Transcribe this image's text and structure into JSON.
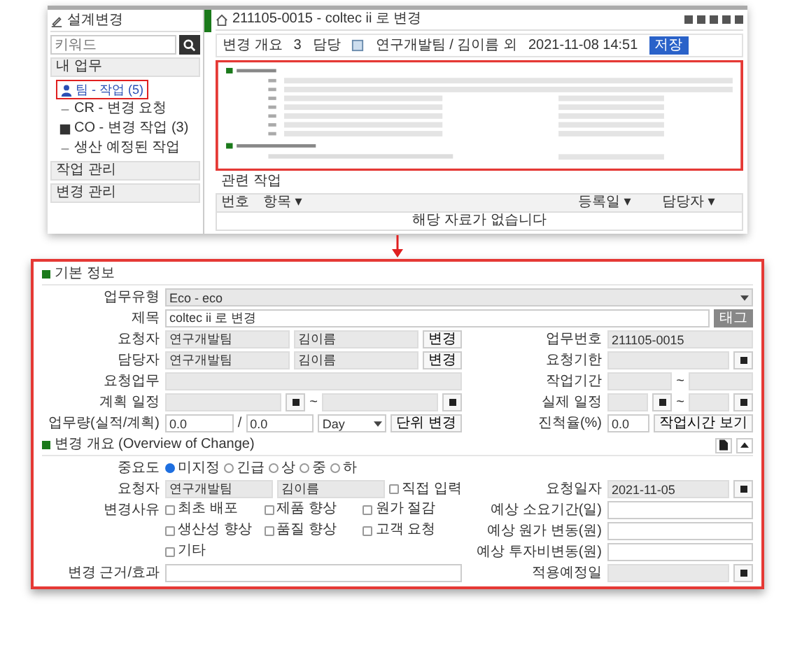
{
  "screenshot": {
    "sidebar": {
      "title": "설계변경",
      "search": {
        "placeholder": "키워드"
      },
      "groups": [
        {
          "label": "내 업무",
          "items": [
            {
              "label": "팀 - 작업 (5)",
              "selected": true,
              "kind": "user"
            },
            {
              "label": "CR - 변경 요청",
              "selected": false,
              "kind": "bullet"
            },
            {
              "label": "CO - 변경 작업 (3)",
              "selected": false,
              "kind": "folder"
            },
            {
              "label": "생산 예정된 작업",
              "selected": false,
              "kind": "bullet"
            }
          ]
        },
        {
          "label": "작업 관리"
        },
        {
          "label": "변경 관리"
        }
      ]
    },
    "breadcrumb": "211105-0015 - coltec ii 로 변경",
    "info": {
      "cells": [
        "변경 개요",
        "3",
        "담당"
      ],
      "assignee": "연구개발팀 / 김이름 외",
      "datetime": "2021-11-08 14:51",
      "button": "저장"
    },
    "related": {
      "title": "관련 작업",
      "columns": [
        "번호",
        "항목 ▾",
        "등록일 ▾",
        "담당자 ▾"
      ],
      "empty": "해당 자료가 없습니다"
    }
  },
  "form": {
    "sections": [
      {
        "title": "기본 정보",
        "rows": [
          {
            "full": {
              "label": "업무유형",
              "controls": [
                {
                  "kind": "select",
                  "value": "Eco - eco",
                  "readonly": true
                }
              ]
            }
          },
          {
            "full": {
              "label": "제목",
              "controls": [
                {
                  "kind": "input",
                  "value": "coltec ii 로 변경",
                  "readonly": false
                },
                {
                  "kind": "dark-button",
                  "label": "태그"
                }
              ]
            }
          },
          {
            "left": {
              "label": "요청자",
              "controls": [
                {
                  "kind": "input",
                  "value": "연구개발팀",
                  "readonly": true
                },
                {
                  "kind": "input",
                  "value": "김이름",
                  "readonly": true
                },
                {
                  "kind": "button",
                  "label": "변경"
                }
              ]
            },
            "right": [
              {
                "label": "업무번호",
                "controls": [
                  {
                    "kind": "input",
                    "value": "211105-0015",
                    "readonly": true
                  }
                ]
              }
            ]
          },
          {
            "left": {
              "label": "담당자",
              "controls": [
                {
                  "kind": "input",
                  "value": "연구개발팀",
                  "readonly": true
                },
                {
                  "kind": "input",
                  "value": "김이름",
                  "readonly": true
                },
                {
                  "kind": "button",
                  "label": "변경"
                }
              ]
            },
            "right": [
              {
                "label": "요청기한",
                "controls": [
                  {
                    "kind": "input",
                    "readonly": true
                  },
                  {
                    "kind": "calendar"
                  }
                ]
              }
            ]
          },
          {
            "left": {
              "label": "요청업무",
              "controls": [
                {
                  "kind": "input",
                  "readonly": true
                }
              ]
            },
            "right": [
              {
                "label": "작업기간",
                "controls": [
                  {
                    "kind": "input",
                    "readonly": true
                  },
                  {
                    "kind": "text",
                    "label": "~"
                  },
                  {
                    "kind": "input",
                    "readonly": true
                  }
                ]
              }
            ]
          },
          {
            "left": {
              "label": "계획 일정",
              "controls": [
                {
                  "kind": "input",
                  "readonly": true
                },
                {
                  "kind": "calendar"
                },
                {
                  "kind": "text",
                  "label": "~"
                },
                {
                  "kind": "input",
                  "readonly": true
                },
                {
                  "kind": "calendar"
                }
              ]
            },
            "right": [
              {
                "label": "실제 일정",
                "controls": [
                  {
                    "kind": "input",
                    "readonly": true
                  },
                  {
                    "kind": "calendar"
                  },
                  {
                    "kind": "text",
                    "label": "~"
                  },
                  {
                    "kind": "input",
                    "readonly": true
                  },
                  {
                    "kind": "calendar"
                  }
                ]
              }
            ]
          },
          {
            "left": {
              "label": "업무량(실적/계획)",
              "controls": [
                {
                  "kind": "input",
                  "value": "0.0",
                  "readonly": false
                },
                {
                  "kind": "text",
                  "label": "/"
                },
                {
                  "kind": "input",
                  "value": "0.0",
                  "readonly": false
                },
                {
                  "kind": "select",
                  "value": "Day",
                  "readonly": false
                },
                {
                  "kind": "button",
                  "label": "단위 변경"
                }
              ]
            },
            "right": [
              {
                "label": "진척율(%)",
                "controls": [
                  {
                    "kind": "input",
                    "value": "0.0",
                    "readonly": false
                  },
                  {
                    "kind": "button",
                    "label": "작업시간 보기"
                  }
                ]
              }
            ]
          }
        ]
      },
      {
        "title": "변경 개요 (Overview of Change)",
        "tools": true,
        "rows": [
          {
            "full": {
              "label": "중요도",
              "controls": [
                {
                  "kind": "radio",
                  "label": "미지정",
                  "selected": true
                },
                {
                  "kind": "radio",
                  "label": "긴급",
                  "selected": false
                },
                {
                  "kind": "radio",
                  "label": "상",
                  "selected": false
                },
                {
                  "kind": "radio",
                  "label": "중",
                  "selected": false
                },
                {
                  "kind": "radio",
                  "label": "하",
                  "selected": false
                }
              ]
            }
          },
          {
            "left": {
              "label": "요청자",
              "controls": [
                {
                  "kind": "input",
                  "value": "연구개발팀",
                  "readonly": true
                },
                {
                  "kind": "input",
                  "value": "김이름",
                  "readonly": true
                },
                {
                  "kind": "check",
                  "label": "직접 입력",
                  "checked": false
                }
              ]
            },
            "right": [
              {
                "label": "요청일자",
                "controls": [
                  {
                    "kind": "input",
                    "value": "2021-11-05",
                    "readonly": true
                  },
                  {
                    "kind": "calendar"
                  }
                ]
              }
            ]
          },
          {
            "left": {
              "label": "변경사유",
              "controls": [
                {
                  "kind": "checks",
                  "items": [
                    {
                      "label": "최초 배포",
                      "checked": false
                    },
                    {
                      "label": "제품 향상",
                      "checked": false
                    },
                    {
                      "label": "원가 절감",
                      "checked": false
                    },
                    {
                      "label": "생산성 향상",
                      "checked": false
                    },
                    {
                      "label": "품질 향상",
                      "checked": false
                    },
                    {
                      "label": "고객 요청",
                      "checked": false
                    },
                    {
                      "label": "기타",
                      "checked": false
                    }
                  ]
                }
              ]
            },
            "right": [
              {
                "label": "예상 소요기간(일)",
                "controls": [
                  {
                    "kind": "input",
                    "readonly": false
                  }
                ]
              },
              {
                "label": "예상 원가 변동(원)",
                "controls": [
                  {
                    "kind": "input",
                    "readonly": false
                  }
                ]
              },
              {
                "label": "예상 투자비변동(원)",
                "controls": [
                  {
                    "kind": "input",
                    "readonly": false
                  }
                ]
              }
            ]
          },
          {
            "left": {
              "label": "변경 근거/효과",
              "controls": [
                {
                  "kind": "input",
                  "readonly": false
                }
              ]
            },
            "right": [
              {
                "label": "적용예정일",
                "controls": [
                  {
                    "kind": "input",
                    "readonly": true
                  },
                  {
                    "kind": "calendar"
                  }
                ]
              }
            ]
          }
        ]
      }
    ]
  }
}
